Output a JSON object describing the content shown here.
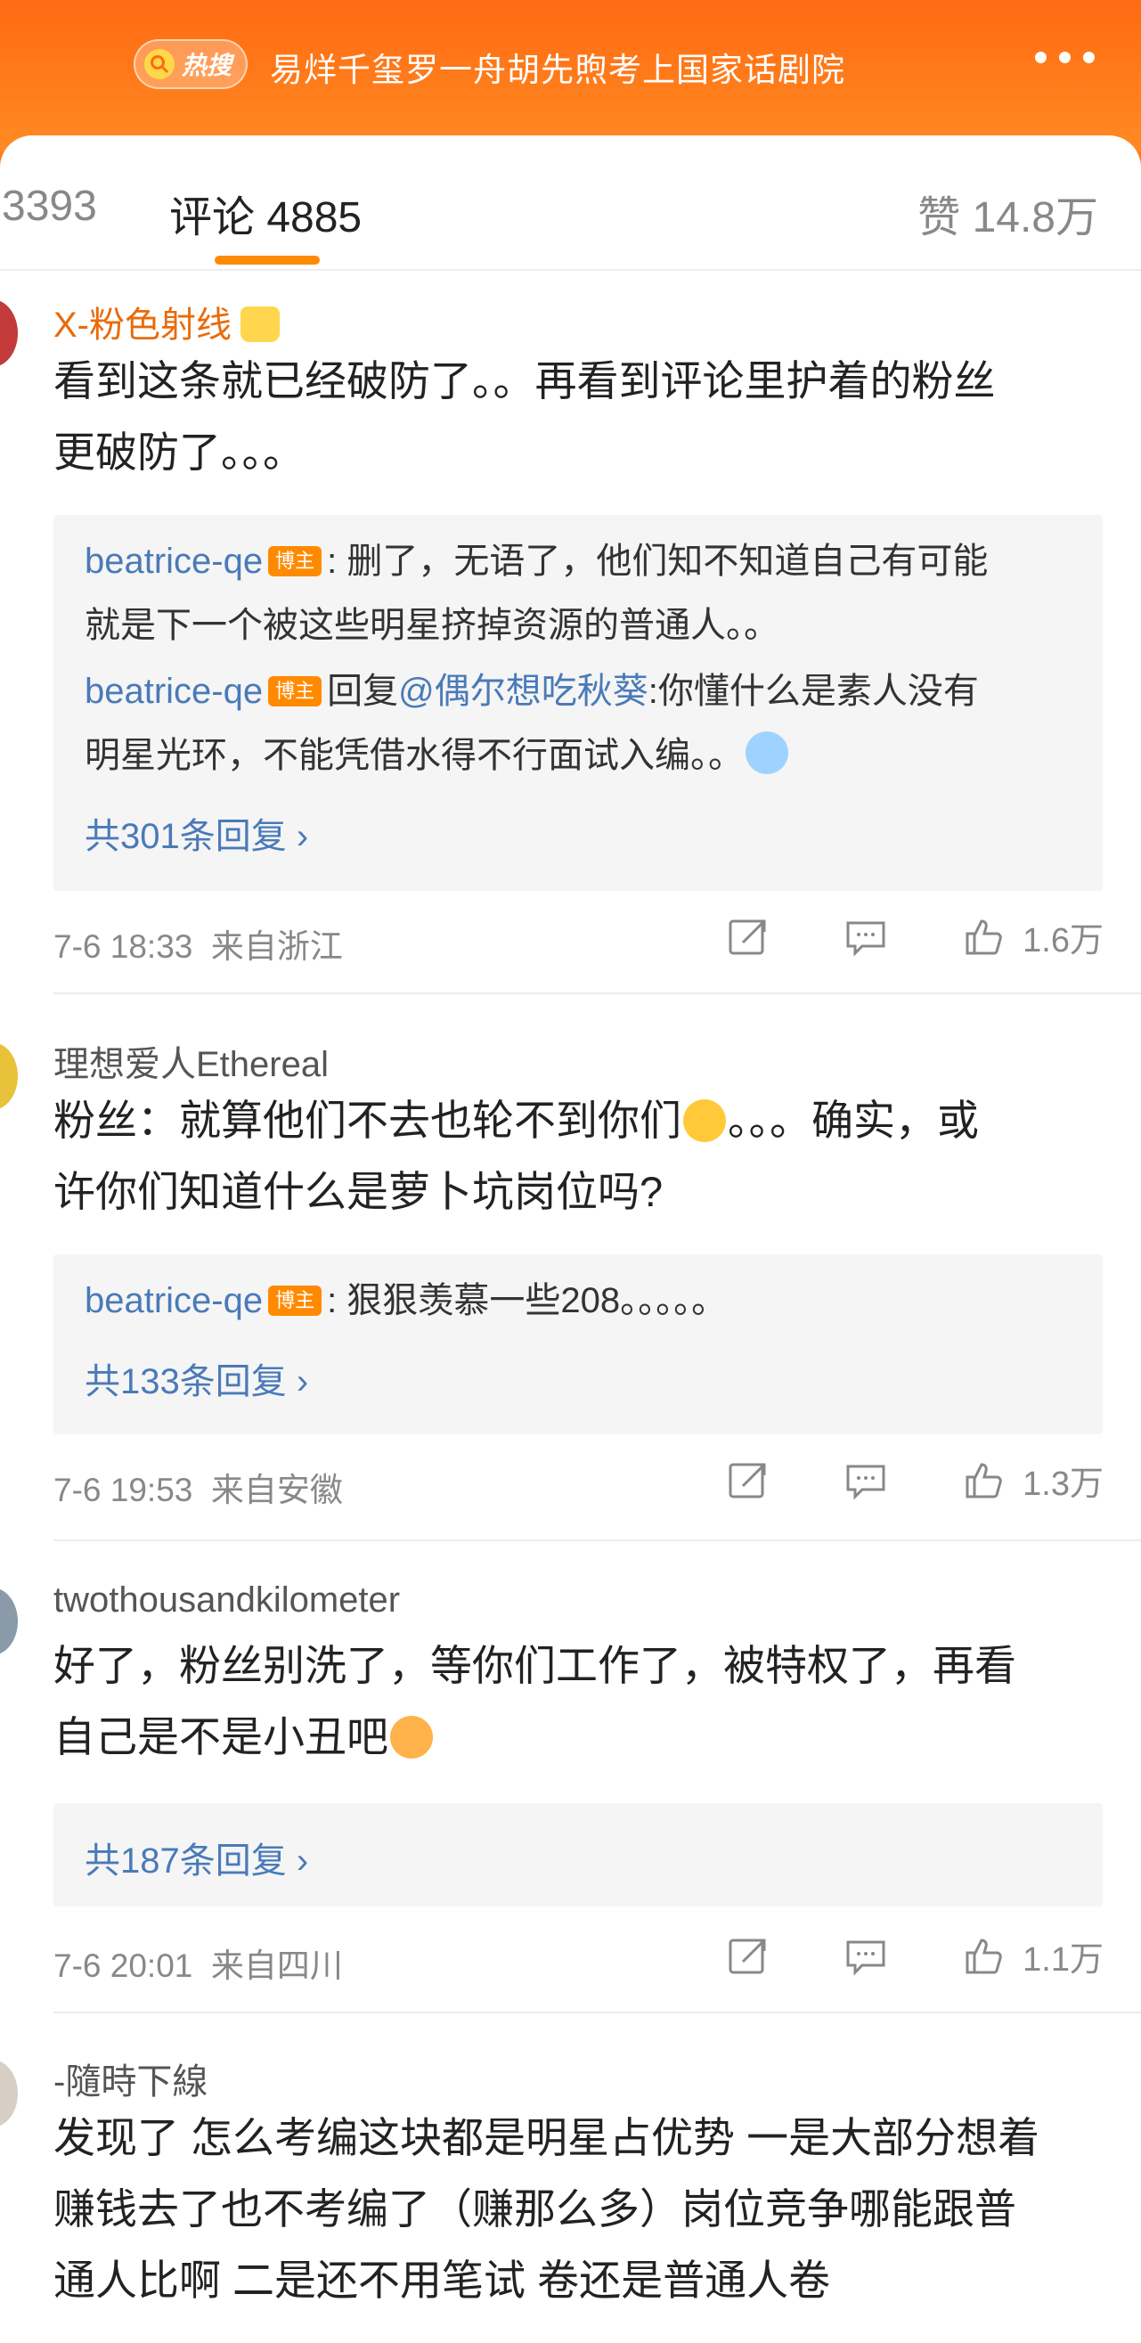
{
  "topbar": {
    "hot_label": "热搜",
    "topic": "易烊千玺罗一舟胡先煦考上国家话剧院"
  },
  "tabs": {
    "repost": "3393",
    "comments": "评论 4885",
    "likes": "赞 14.8万"
  },
  "comments": [
    {
      "name": "X-粉色射线",
      "lines": [
        "看到这条就已经破防了。。再看到评论里护着的粉丝",
        "更破防了。。。"
      ],
      "replies": [
        {
          "user": "beatrice-qe",
          "tag": "博主",
          "sep": ":",
          "text": " 删了，无语了，他们知不知道自己有可能",
          "text2": "就是下一个被这些明星挤掉资源的普通人。。"
        },
        {
          "user": "beatrice-qe",
          "tag": "博主",
          "prefix": "回复",
          "mention": "@偶尔想吃秋葵",
          "text": ":你懂什么是素人没有",
          "text2": "明星光环，不能凭借水得不行面试入编。。"
        }
      ],
      "more": "共301条回复",
      "date": "7-6 18:33",
      "location": "来自浙江",
      "likes": "1.6万"
    },
    {
      "name": "理想爱人Ethereal",
      "lines": [
        "粉丝：就算他们不去也轮不到你们",
        "。。。确实，或",
        "许你们知道什么是萝卜坑岗位吗?"
      ],
      "replies": [
        {
          "user": "beatrice-qe",
          "tag": "博主",
          "sep": ":",
          "text": " 狠狠羡慕一些208。。。。。"
        }
      ],
      "more": "共133条回复",
      "date": "7-6 19:53",
      "location": "来自安徽",
      "likes": "1.3万"
    },
    {
      "name": "twothousandkilometer",
      "lines": [
        "好了，粉丝别洗了，等你们工作了，被特权了，再看",
        "自己是不是小丑吧"
      ],
      "more": "共187条回复",
      "date": "7-6 20:01",
      "location": "来自四川",
      "likes": "1.1万"
    },
    {
      "name": "-隨時下線",
      "lines": [
        "发现了 怎么考编这块都是明星占优势 一是大部分想着",
        "赚钱去了也不考编了（赚那么多）岗位竞争哪能跟普",
        "通人比啊 二是还不用笔试 卷还是普通人卷"
      ]
    }
  ],
  "colors": {
    "brand_orange": "#ff7a1a",
    "vip_name": "#e86b0a",
    "link_blue": "#4a7ab8",
    "tab_underline": "#ff8a00"
  },
  "icons": [
    "search-icon",
    "more-dots-icon",
    "crown-icon",
    "share-icon",
    "comment-icon",
    "like-icon",
    "chevron-right-icon",
    "emoji-icon"
  ]
}
